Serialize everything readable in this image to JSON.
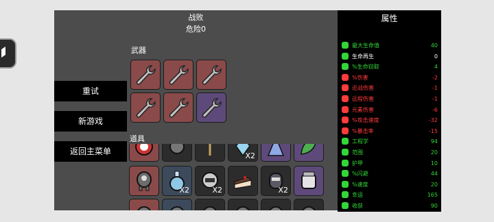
{
  "header": {
    "title": "战败",
    "danger": "危险0"
  },
  "sections": {
    "weapons": "武器",
    "items": "道具"
  },
  "menu": {
    "retry": "重试",
    "new_game": "新游戏",
    "main_menu": "返回主菜单"
  },
  "stats": {
    "title": "属性",
    "rows": [
      {
        "label": "最大生命值",
        "value": "40",
        "color": "#33d639",
        "icon": "heart-icon"
      },
      {
        "label": "生命再生",
        "value": "0",
        "color": "#ffffff",
        "icon": "regen-icon"
      },
      {
        "label": "%生命窃取",
        "value": "4",
        "color": "#33d639",
        "icon": "lifesteal-icon"
      },
      {
        "label": "%伤害",
        "value": "-2",
        "color": "#ff3b3b",
        "icon": "damage-icon"
      },
      {
        "label": "近战伤害",
        "value": "-1",
        "color": "#ff3b3b",
        "icon": "melee-icon"
      },
      {
        "label": "远程伤害",
        "value": "-1",
        "color": "#ff3b3b",
        "icon": "ranged-icon"
      },
      {
        "label": "元素伤害",
        "value": "-6",
        "color": "#ff3b3b",
        "icon": "elemental-icon"
      },
      {
        "label": "%攻击速度",
        "value": "-32",
        "color": "#ff3b3b",
        "icon": "attack-speed-icon"
      },
      {
        "label": "%暴击率",
        "value": "-15",
        "color": "#ff3b3b",
        "icon": "crit-icon"
      },
      {
        "label": "工程学",
        "value": "94",
        "color": "#33d639",
        "icon": "engineering-icon"
      },
      {
        "label": "范围",
        "value": "20",
        "color": "#33d639",
        "icon": "range-icon"
      },
      {
        "label": "护甲",
        "value": "10",
        "color": "#33d639",
        "icon": "armor-icon"
      },
      {
        "label": "%闪避",
        "value": "44",
        "color": "#33d639",
        "icon": "dodge-icon"
      },
      {
        "label": "%速度",
        "value": "20",
        "color": "#33d639",
        "icon": "speed-icon"
      },
      {
        "label": "幸运",
        "value": "165",
        "color": "#33d639",
        "icon": "luck-icon"
      },
      {
        "label": "收获",
        "value": "90",
        "color": "#33d639",
        "icon": "harvest-icon"
      }
    ]
  },
  "weapons": [
    {
      "tier": "red",
      "icon": "wrench-icon"
    },
    {
      "tier": "red",
      "icon": "wrench-icon"
    },
    {
      "tier": "red",
      "icon": "wrench-icon"
    },
    {
      "tier": "red",
      "icon": "wrench-icon"
    },
    {
      "tier": "red",
      "icon": "wrench-icon"
    },
    {
      "tier": "purple",
      "icon": "wrench-icon"
    }
  ],
  "items": {
    "partial_top": [
      {
        "tier": "red",
        "icon": "target-icon",
        "qty": ""
      },
      {
        "tier": "dark",
        "icon": "item-icon",
        "qty": ""
      },
      {
        "tier": "dark",
        "icon": "wheat-icon",
        "qty": ""
      },
      {
        "tier": "dark",
        "icon": "crystal-icon",
        "qty": "X2"
      },
      {
        "tier": "purple",
        "icon": "cone-icon",
        "qty": ""
      },
      {
        "tier": "purple",
        "icon": "leaf-icon",
        "qty": ""
      }
    ],
    "full_row": [
      {
        "tier": "red",
        "icon": "turret-icon",
        "qty": ""
      },
      {
        "tier": "blue",
        "icon": "potion-icon",
        "qty": "X2"
      },
      {
        "tier": "dark",
        "icon": "helmet-icon",
        "qty": "X2"
      },
      {
        "tier": "dark",
        "icon": "cake-icon",
        "qty": ""
      },
      {
        "tier": "dark",
        "icon": "robot-icon",
        "qty": "X2"
      },
      {
        "tier": "purple",
        "icon": "jar-icon",
        "qty": ""
      }
    ],
    "partial_bottom": [
      {
        "tier": "red",
        "icon": "item-icon",
        "qty": ""
      },
      {
        "tier": "blue",
        "icon": "item-icon",
        "qty": ""
      },
      {
        "tier": "dark",
        "icon": "item-icon",
        "qty": ""
      },
      {
        "tier": "dark",
        "icon": "item-icon",
        "qty": ""
      },
      {
        "tier": "dark",
        "icon": "item-icon",
        "qty": ""
      },
      {
        "tier": "dark",
        "icon": "item-icon",
        "qty": ""
      }
    ]
  }
}
